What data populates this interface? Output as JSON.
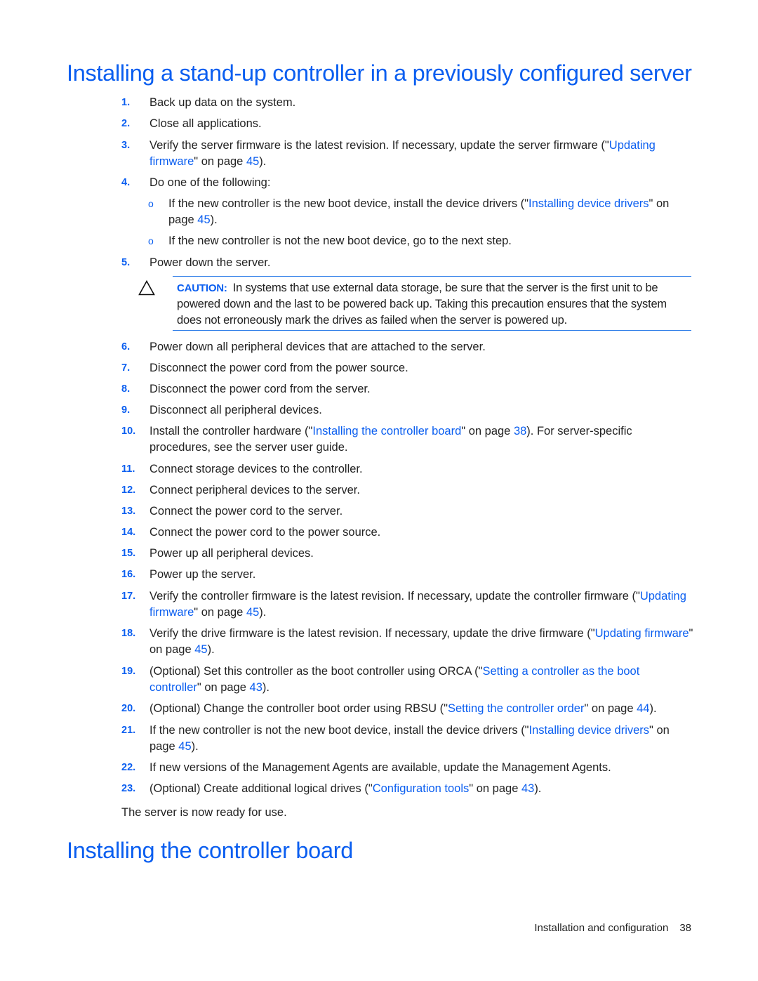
{
  "section1": {
    "title": "Installing a stand-up controller in a previously configured server",
    "steps": [
      {
        "num": "1.",
        "parts": [
          {
            "t": "Back up data on the system."
          }
        ]
      },
      {
        "num": "2.",
        "parts": [
          {
            "t": "Close all applications."
          }
        ]
      },
      {
        "num": "3.",
        "parts": [
          {
            "t": "Verify the server firmware is the latest revision. If necessary, update the server firmware (\""
          },
          {
            "link": "Updating firmware"
          },
          {
            "t": "\" on page "
          },
          {
            "link": "45"
          },
          {
            "t": ")."
          }
        ]
      },
      {
        "num": "4.",
        "parts": [
          {
            "t": "Do one of the following:"
          }
        ]
      },
      {
        "num": "5.",
        "parts": [
          {
            "t": "Power down the server."
          }
        ]
      },
      {
        "num": "6.",
        "parts": [
          {
            "t": "Power down all peripheral devices that are attached to the server."
          }
        ]
      },
      {
        "num": "7.",
        "parts": [
          {
            "t": "Disconnect the power cord from the power source."
          }
        ]
      },
      {
        "num": "8.",
        "parts": [
          {
            "t": "Disconnect the power cord from the server."
          }
        ]
      },
      {
        "num": "9.",
        "parts": [
          {
            "t": "Disconnect all peripheral devices."
          }
        ]
      },
      {
        "num": "10.",
        "parts": [
          {
            "t": "Install the controller hardware (\""
          },
          {
            "link": "Installing the controller board"
          },
          {
            "t": "\" on page "
          },
          {
            "link": "38"
          },
          {
            "t": "). For server-specific procedures, see the server user guide."
          }
        ]
      },
      {
        "num": "11.",
        "parts": [
          {
            "t": "Connect storage devices to the controller."
          }
        ]
      },
      {
        "num": "12.",
        "parts": [
          {
            "t": "Connect peripheral devices to the server."
          }
        ]
      },
      {
        "num": "13.",
        "parts": [
          {
            "t": "Connect the power cord to the server."
          }
        ]
      },
      {
        "num": "14.",
        "parts": [
          {
            "t": "Connect the power cord to the power source."
          }
        ]
      },
      {
        "num": "15.",
        "parts": [
          {
            "t": "Power up all peripheral devices."
          }
        ]
      },
      {
        "num": "16.",
        "parts": [
          {
            "t": "Power up the server."
          }
        ]
      },
      {
        "num": "17.",
        "parts": [
          {
            "t": "Verify the controller firmware is the latest revision. If necessary, update the controller firmware (\""
          },
          {
            "link": "Updating firmware"
          },
          {
            "t": "\" on page "
          },
          {
            "link": "45"
          },
          {
            "t": ")."
          }
        ]
      },
      {
        "num": "18.",
        "parts": [
          {
            "t": "Verify the drive firmware is the latest revision. If necessary, update the drive firmware (\""
          },
          {
            "link": "Updating firmware"
          },
          {
            "t": "\" on page "
          },
          {
            "link": "45"
          },
          {
            "t": ")."
          }
        ]
      },
      {
        "num": "19.",
        "parts": [
          {
            "t": "(Optional) Set this controller as the boot controller using ORCA (\""
          },
          {
            "link": "Setting a controller as the boot controller"
          },
          {
            "t": "\" on page "
          },
          {
            "link": "43"
          },
          {
            "t": ")."
          }
        ]
      },
      {
        "num": "20.",
        "parts": [
          {
            "t": "(Optional) Change the controller boot order using RBSU (\""
          },
          {
            "link": "Setting the controller order"
          },
          {
            "t": "\" on page "
          },
          {
            "link": "44"
          },
          {
            "t": ")."
          }
        ]
      },
      {
        "num": "21.",
        "parts": [
          {
            "t": "If the new controller is not the new boot device, install the device drivers (\""
          },
          {
            "link": "Installing device drivers"
          },
          {
            "t": "\" on page "
          },
          {
            "link": "45"
          },
          {
            "t": ")."
          }
        ]
      },
      {
        "num": "22.",
        "parts": [
          {
            "t": "If new versions of the Management Agents are available, update the Management Agents."
          }
        ]
      },
      {
        "num": "23.",
        "parts": [
          {
            "t": "(Optional) Create additional logical drives (\""
          },
          {
            "link": "Configuration tools"
          },
          {
            "t": "\" on page "
          },
          {
            "link": "43"
          },
          {
            "t": ")."
          }
        ]
      }
    ],
    "substeps": [
      {
        "bullet": "o",
        "parts": [
          {
            "t": "If the new controller is the new boot device, install the device drivers (\""
          },
          {
            "link": "Installing device drivers"
          },
          {
            "t": "\" on page "
          },
          {
            "link": "45"
          },
          {
            "t": ")."
          }
        ]
      },
      {
        "bullet": "o",
        "parts": [
          {
            "t": "If the new controller is not the new boot device, go to the next step."
          }
        ]
      }
    ],
    "caution": {
      "icon": "warning-triangle-icon",
      "label": "CAUTION:",
      "text": "In systems that use external data storage, be sure that the server is the first unit to be powered down and the last to be powered back up. Taking this precaution ensures that the system does not erroneously mark the drives as failed when the server is powered up."
    },
    "closing": "The server is now ready for use."
  },
  "section2": {
    "title": "Installing the controller board"
  },
  "footer": {
    "chapter": "Installation and configuration",
    "page": "38"
  },
  "colors": {
    "heading": "#0a5ef0",
    "link": "#0a5ef0",
    "rule": "#2b7be8",
    "body_text": "#222222"
  }
}
